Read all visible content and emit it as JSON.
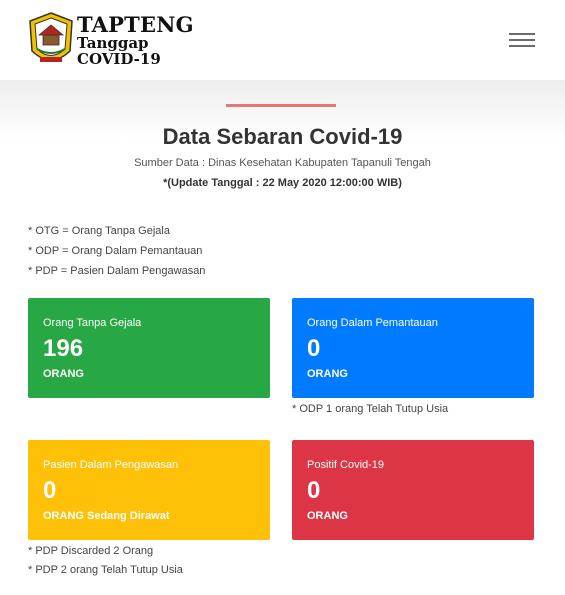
{
  "header": {
    "brand_line1": "TAPTENG",
    "brand_line2": "Tanggap",
    "brand_line3": "COVID-19",
    "menu_icon": "hamburger-menu-icon",
    "accent_color": "#e27a74"
  },
  "main": {
    "title": "Data Sebaran Covid-19",
    "source": "Sumber Data : Dinas Kesehatan Kabupaten Tapanuli Tengah",
    "update": "*(Update Tanggal : 22 May 2020 12:00:00 WIB)"
  },
  "legend": [
    "* OTG = Orang Tanpa Gejala",
    "* ODP = Orang Dalam Pemantauan",
    "* PDP = Pasien Dalam Pengawasan"
  ],
  "cards": {
    "otg": {
      "label": "Orang Tanpa Gejala",
      "value": "196",
      "unit": "ORANG",
      "color": "#28a745"
    },
    "odp": {
      "label": "Orang Dalam Pemantauan",
      "value": "0",
      "unit": "ORANG",
      "color": "#007bff"
    },
    "pdp": {
      "label": "Pasien Dalam Pengawasan",
      "value": "0",
      "unit": "ORANG Sedang Dirawat",
      "color": "#ffc107"
    },
    "positif": {
      "label": "Positif Covid-19",
      "value": "0",
      "unit": "ORANG",
      "color": "#dc3545"
    }
  },
  "notes": {
    "odp": "* ODP 1 orang Telah Tutup Usia",
    "pdp_1": "* PDP Discarded 2 Orang",
    "pdp_2": "* PDP 2 orang Telah Tutup Usia"
  }
}
